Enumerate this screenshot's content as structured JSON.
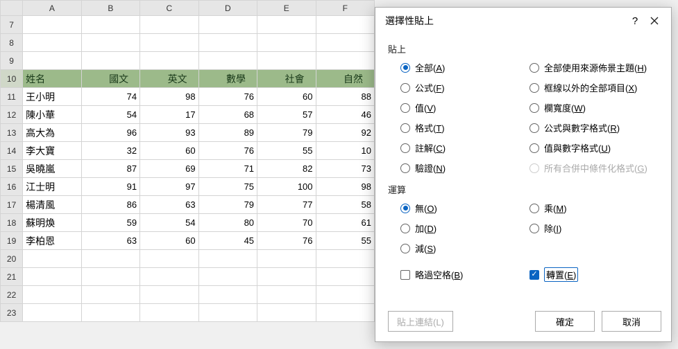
{
  "sheet": {
    "colHeaders": [
      "A",
      "B",
      "C",
      "D",
      "E",
      "F"
    ],
    "rowStart": 7,
    "rowEnd": 23,
    "headerRowIndex": 10,
    "header": {
      "name": "姓名",
      "subjects": [
        "國文",
        "英文",
        "數學",
        "社會",
        "自然"
      ]
    },
    "rows": [
      {
        "name": "王小明",
        "scores": [
          74,
          98,
          76,
          60,
          88
        ]
      },
      {
        "name": "陳小華",
        "scores": [
          54,
          17,
          68,
          57,
          46
        ]
      },
      {
        "name": "高大為",
        "scores": [
          96,
          93,
          89,
          79,
          92
        ]
      },
      {
        "name": "李大寶",
        "scores": [
          32,
          60,
          76,
          55,
          10
        ]
      },
      {
        "name": "吳曉嵐",
        "scores": [
          87,
          69,
          71,
          82,
          73
        ]
      },
      {
        "name": "江士明",
        "scores": [
          91,
          97,
          75,
          100,
          98
        ]
      },
      {
        "name": "楊清風",
        "scores": [
          86,
          63,
          79,
          77,
          58
        ]
      },
      {
        "name": "蘇明煥",
        "scores": [
          59,
          54,
          80,
          70,
          61
        ]
      },
      {
        "name": "李柏恩",
        "scores": [
          63,
          60,
          45,
          76,
          55
        ]
      }
    ]
  },
  "dialog": {
    "title": "選擇性貼上",
    "help": "?",
    "section_paste": "貼上",
    "paste_options": {
      "all": {
        "label": "全部(",
        "key": "A",
        "tail": ")",
        "checked": true
      },
      "formulas": {
        "label": "公式(",
        "key": "F",
        "tail": ")"
      },
      "values": {
        "label": "值(",
        "key": "V",
        "tail": ")"
      },
      "formats": {
        "label": "格式(",
        "key": "T",
        "tail": ")"
      },
      "comments": {
        "label": "註解(",
        "key": "C",
        "tail": ")"
      },
      "validation": {
        "label": "驗證(",
        "key": "N",
        "tail": ")"
      },
      "theme": {
        "label": "全部使用來源佈景主題(",
        "key": "H",
        "tail": ")"
      },
      "noborder": {
        "label": "框線以外的全部項目(",
        "key": "X",
        "tail": ")"
      },
      "colwidth": {
        "label": "欄寬度(",
        "key": "W",
        "tail": ")"
      },
      "fmtnum": {
        "label": "公式與數字格式(",
        "key": "R",
        "tail": ")"
      },
      "valnum": {
        "label": "值與數字格式(",
        "key": "U",
        "tail": ")"
      },
      "condfmt": {
        "label": "所有合併中條件化格式(",
        "key": "G",
        "tail": ")",
        "disabled": true
      }
    },
    "section_operation": "運算",
    "op_options": {
      "none": {
        "label": "無(",
        "key": "O",
        "tail": ")",
        "checked": true
      },
      "add": {
        "label": "加(",
        "key": "D",
        "tail": ")"
      },
      "subtract": {
        "label": "減(",
        "key": "S",
        "tail": ")"
      },
      "multiply": {
        "label": "乘(",
        "key": "M",
        "tail": ")"
      },
      "divide": {
        "label": "除(",
        "key": "I",
        "tail": ")"
      }
    },
    "checks": {
      "skip": {
        "label": "略過空格(",
        "key": "B",
        "tail": ")",
        "checked": false
      },
      "transpose": {
        "label": "轉置(",
        "key": "E",
        "tail": ")",
        "checked": true
      }
    },
    "buttons": {
      "pastelink": "貼上連結(L)",
      "ok": "確定",
      "cancel": "取消"
    }
  }
}
